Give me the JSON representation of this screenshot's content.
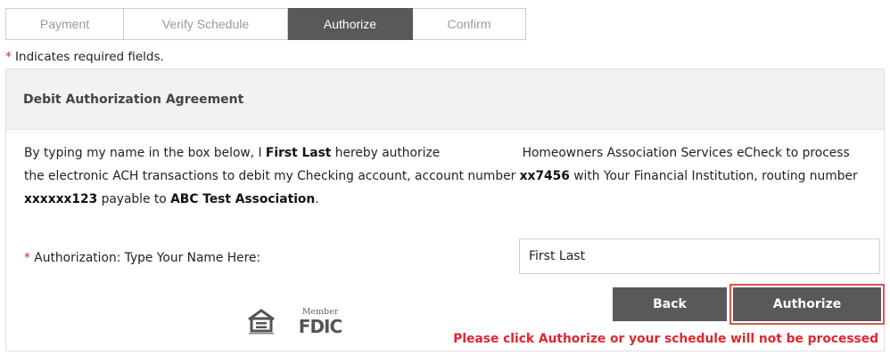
{
  "tabs": [
    {
      "label": "Payment",
      "active": false
    },
    {
      "label": "Verify Schedule",
      "active": false
    },
    {
      "label": "Authorize",
      "active": true
    },
    {
      "label": "Confirm",
      "active": false
    }
  ],
  "required_note": {
    "star": "*",
    "text": " Indicates required fields."
  },
  "panel": {
    "title": "Debit Authorization Agreement",
    "agreement": {
      "p1": "By typing my name in the box below, I ",
      "name": "First Last",
      "p2": " hereby authorize ",
      "company": "Homeowners Association Services",
      "p3": " eCheck to process the electronic ACH transactions to debit my Checking account, account number ",
      "account": "xx7456",
      "p4": " with Your Financial Institution, routing number ",
      "routing": "xxxxxx123",
      "p5": " payable to ",
      "payee": "ABC Test  Association",
      "p6": "."
    },
    "auth_field": {
      "star": "*",
      "label": " Authorization: Type Your Name Here:",
      "value": "First Last"
    },
    "buttons": {
      "back": "Back",
      "authorize": "Authorize"
    },
    "warning": "Please click Authorize or your schedule will not be processed",
    "logos": {
      "fdic_member": "Member",
      "fdic": "FDIC",
      "equal_housing_icon": "equal-housing-lender-icon"
    }
  },
  "colors": {
    "tab_active": "#595959",
    "button": "#595959",
    "required_star": "#d9262c",
    "warning": "#e0262d",
    "highlight_border": "#d9534f"
  }
}
